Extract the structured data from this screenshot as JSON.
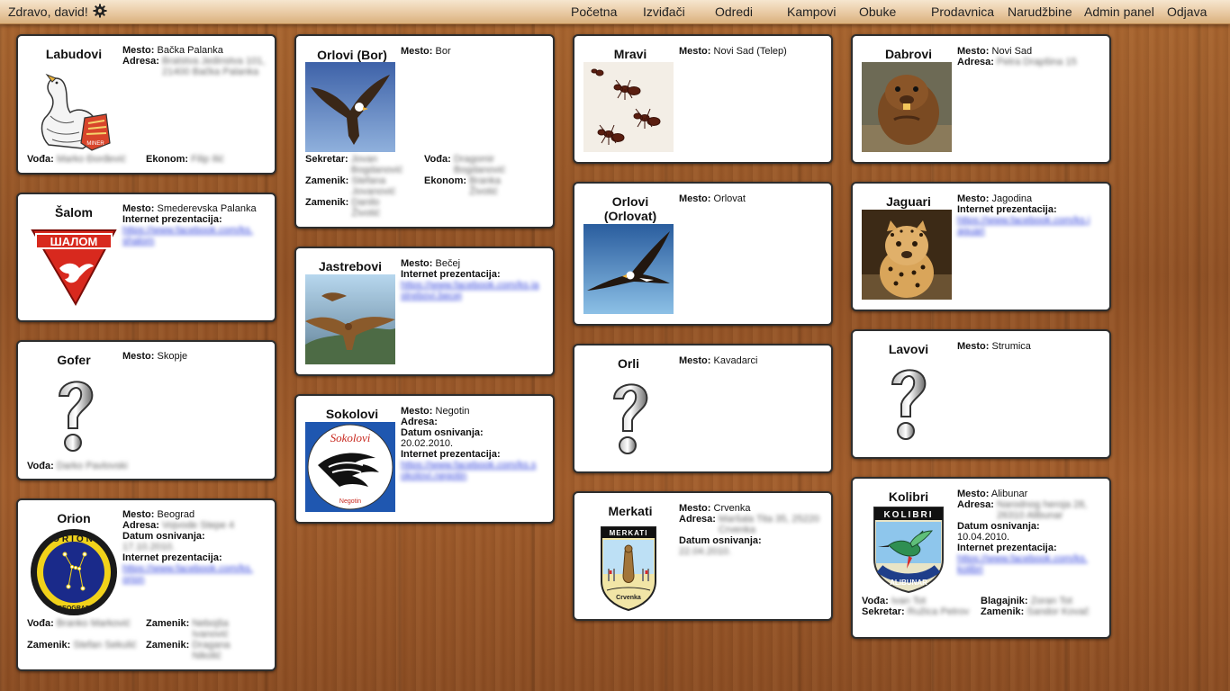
{
  "nav": {
    "greeting": "Zdravo, david!",
    "links": [
      "Početna",
      "Izviđači",
      "Odredi",
      "Kampovi",
      "Obuke",
      "Prodavnica",
      "Narudžbine",
      "Admin panel",
      "Odjava"
    ]
  },
  "labels": {
    "mesto": "Mesto:",
    "adresa": "Adresa:",
    "internet": "Internet prezentacija:",
    "datum": "Datum osnivanja:",
    "vodja": "Vođa:",
    "ekonom": "Ekonom:",
    "sekretar": "Sekretar:",
    "zamenik": "Zamenik:",
    "blagajnik": "Blagajnik:"
  },
  "cards": {
    "labudovi": {
      "name": "Labudovi",
      "mesto": "Bačka Palanka",
      "adresa": "Bratstva Jedinstva 101, 21400 Bačka Palanka",
      "vodja": "Marko Đorđević",
      "ekonom": "Filip Ilić"
    },
    "salom": {
      "name": "Šalom",
      "mesto": "Smederevska Palanka",
      "internet": "https://www.facebook.com/ks.shalom"
    },
    "gofer": {
      "name": "Gofer",
      "mesto": "Skopje",
      "vodja": "Darko Pavlovski"
    },
    "orion": {
      "name": "Orion",
      "mesto": "Beograd",
      "adresa": "Vojvode Stepe 4",
      "datum": "17.10.2010.",
      "internet": "https://www.facebook.com/ks.orion",
      "vodja": "Branko Marković",
      "zamenik1": "Nebojša Ivanović",
      "zamenik2": "Stefan Sekulić",
      "zamenik3": "Dragana Nikolić"
    },
    "orlovi_bor": {
      "name": "Orlovi (Bor)",
      "mesto": "Bor",
      "sekretar": "Jovan Bogdanović",
      "vodja": "Dragomir Bogdanović",
      "zamenik1": "Stefana Jovanović",
      "ekonom": "Branka Životić",
      "zamenik2": "Danilo Životić"
    },
    "jastrebovi": {
      "name": "Jastrebovi",
      "mesto": "Bečej",
      "internet": "https://www.facebook.com/ks.jastrebovi.becej"
    },
    "sokolovi": {
      "name": "Sokolovi",
      "mesto": "Negotin",
      "adresa": "",
      "datum": "20.02.2010.",
      "internet": "https://www.facebook.com/ks.sokolovi.negotin"
    },
    "mravi": {
      "name": "Mravi",
      "mesto": "Novi Sad (Telep)"
    },
    "orlovi_orlovat": {
      "name": "Orlovi (Orlovat)",
      "mesto": "Orlovat"
    },
    "orli": {
      "name": "Orli",
      "mesto": "Kavadarci"
    },
    "merkati": {
      "name": "Merkati",
      "mesto": "Crvenka",
      "adresa": "Maršala Tita 35, 25220 Crvenka",
      "datum": "22.04.2010."
    },
    "dabrovi": {
      "name": "Dabrovi",
      "mesto": "Novi Sad",
      "adresa": "Petra Drapšina 15"
    },
    "jaguari": {
      "name": "Jaguari",
      "mesto": "Jagodina",
      "internet": "https://www.facebook.com/ks.jaguari"
    },
    "lavovi": {
      "name": "Lavovi",
      "mesto": "Strumica"
    },
    "kolibri": {
      "name": "Kolibri",
      "mesto": "Alibunar",
      "adresa": "Narodnog heroja 28, 26310 Alibunar",
      "datum": "10.04.2010.",
      "internet": "https://www.facebook.com/ks.kolibri",
      "vodja": "Ivan Tot",
      "blagajnik": "Zoran Tot",
      "sekretar": "Ružica Petrov",
      "zamenik": "Sandor Kovač"
    }
  },
  "logos": {
    "salom": "ШАЛОМ",
    "sokolovi_top": "Sokolovi",
    "sokolovi_bottom": "Negotin",
    "orion_top": "ORION",
    "orion_bottom": "BEOGRAD",
    "merkati_top": "MERKATI",
    "merkati_bottom": "Crvenka",
    "kolibri_top": "KOLIBRI",
    "kolibri_bottom": "ALIBUNAR"
  }
}
